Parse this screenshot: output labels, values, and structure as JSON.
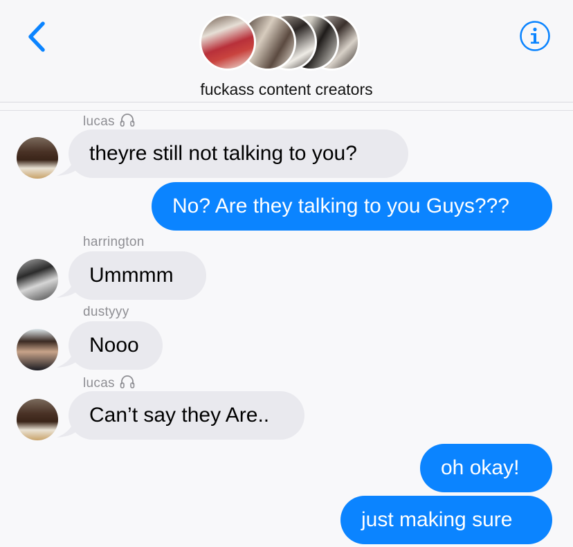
{
  "header": {
    "back_icon": "chevron-left-icon",
    "info_icon": "info-circle-icon",
    "group_name": "fuckass content creators",
    "accent_color": "#0b84ff"
  },
  "messages": [
    {
      "sender": "lucas",
      "sender_icon": "headphones-icon",
      "text": "theyre still not talking to you?",
      "direction": "incoming"
    },
    {
      "text": "No? Are they talking to you Guys???",
      "direction": "outgoing"
    },
    {
      "sender": "harrington",
      "text": "Ummmm",
      "direction": "incoming"
    },
    {
      "sender": "dustyyy",
      "text": "Nooo",
      "direction": "incoming"
    },
    {
      "sender": "lucas",
      "sender_icon": "headphones-icon",
      "text": "Can’t say they Are..",
      "direction": "incoming"
    },
    {
      "text": "oh okay!",
      "direction": "outgoing"
    },
    {
      "text": "just making sure",
      "direction": "outgoing"
    }
  ],
  "colors": {
    "incoming_bubble": "#e9e9ee",
    "outgoing_bubble": "#0b84ff",
    "background": "#f8f8fa"
  }
}
